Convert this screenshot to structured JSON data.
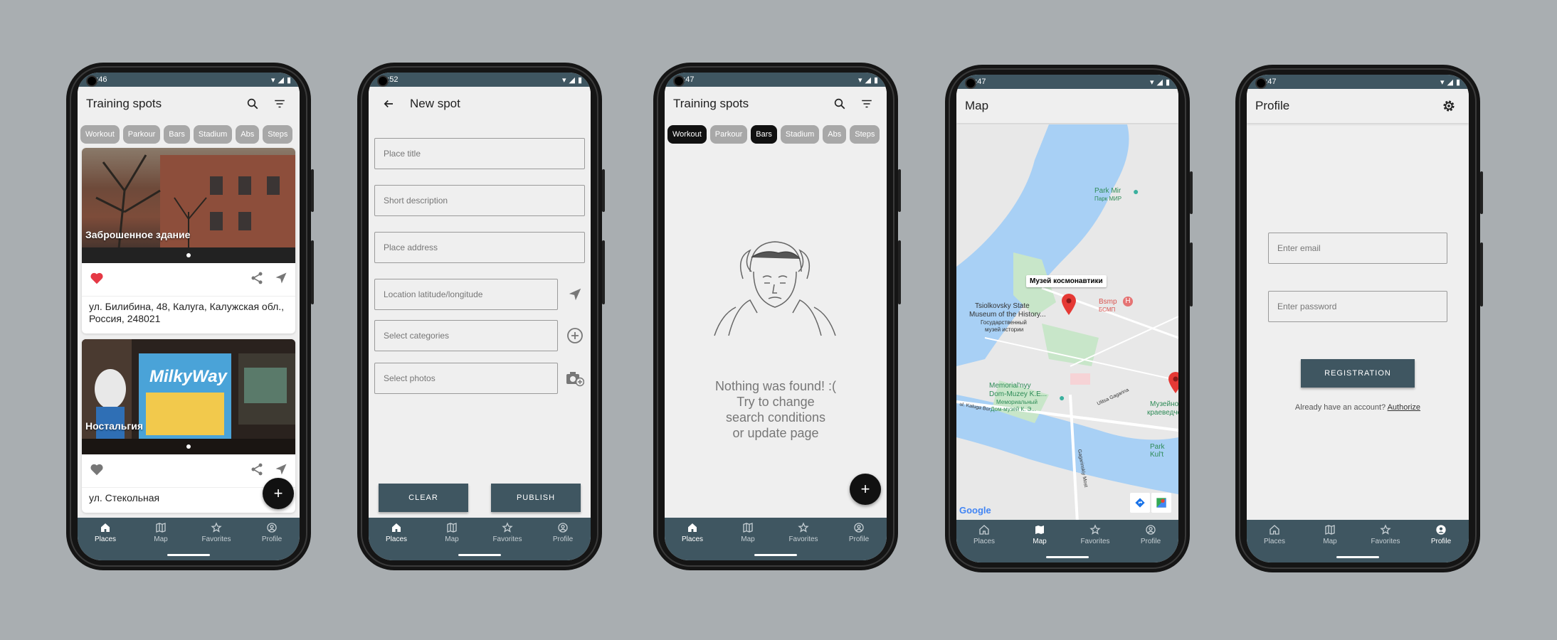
{
  "phones": {
    "places": {
      "time": "10:46",
      "title": "Training spots",
      "chips": [
        "Workout",
        "Parkour",
        "Bars",
        "Stadium",
        "Abs",
        "Steps"
      ],
      "cards": [
        {
          "caption": "Заброшенное здание",
          "address": "ул. Билибина, 48, Калуга, Калужская обл., Россия, 248021",
          "favorite": true
        },
        {
          "caption": "Ностальгия",
          "address": "ул. Стекольная",
          "favorite": false
        }
      ],
      "fab": "+"
    },
    "new_spot": {
      "time": "10:52",
      "title": "New spot",
      "fields": {
        "title": "Place title",
        "description": "Short description",
        "address": "Place address",
        "location": "Location latitude/longitude",
        "categories": "Select categories",
        "photos": "Select photos"
      },
      "clear": "CLEAR",
      "publish": "PUBLISH"
    },
    "empty": {
      "time": "10:47",
      "title": "Training spots",
      "chips": [
        "Workout",
        "Parkour",
        "Bars",
        "Stadium",
        "Abs",
        "Steps"
      ],
      "active_chips": [
        "Workout",
        "Bars"
      ],
      "message": [
        "Nothing was found! :(",
        "Try to change",
        "search conditions",
        "or update page"
      ],
      "fab": "+"
    },
    "map": {
      "time": "10:47",
      "title": "Map",
      "labels": {
        "park_mir": "Park Mir",
        "park_mir_ru": "Парк МИР",
        "tooltip": "Музей космонавтики",
        "museum1": "Tsiolkovsky State",
        "museum2": "Museum of the History...",
        "museum3": "Государственный",
        "museum4": "музей истории",
        "bsmp": "Bsmp",
        "bsmp_ru": "БСМП",
        "memorial1": "Memorial'nyy",
        "memorial2": "Dom-Muzey K.E...",
        "memorial3": "Мемориальный",
        "memorial4": "Дом-музей К. Э...",
        "museum_kr1": "Музейно",
        "museum_kr2": "краеведческий",
        "park_kult": "Park Kul't",
        "street1": "ul. Kaluga Bor",
        "street2": "Ulitsa Gagarina",
        "street3": "Gagarinskiy Most",
        "google": "Google"
      }
    },
    "profile": {
      "time": "10:47",
      "title": "Profile",
      "email": "Enter email",
      "password": "Enter password",
      "registration": "REGISTRATION",
      "have_account": "Already have an account?",
      "authorize": "Authorize"
    }
  },
  "nav": [
    "Places",
    "Map",
    "Favorites",
    "Profile"
  ],
  "colors": {
    "primary": "#3f5661",
    "background": "#a9aeb1",
    "favorite": "#e53945",
    "map_water": "#a8d0f5",
    "map_green": "#c8e6c9"
  }
}
